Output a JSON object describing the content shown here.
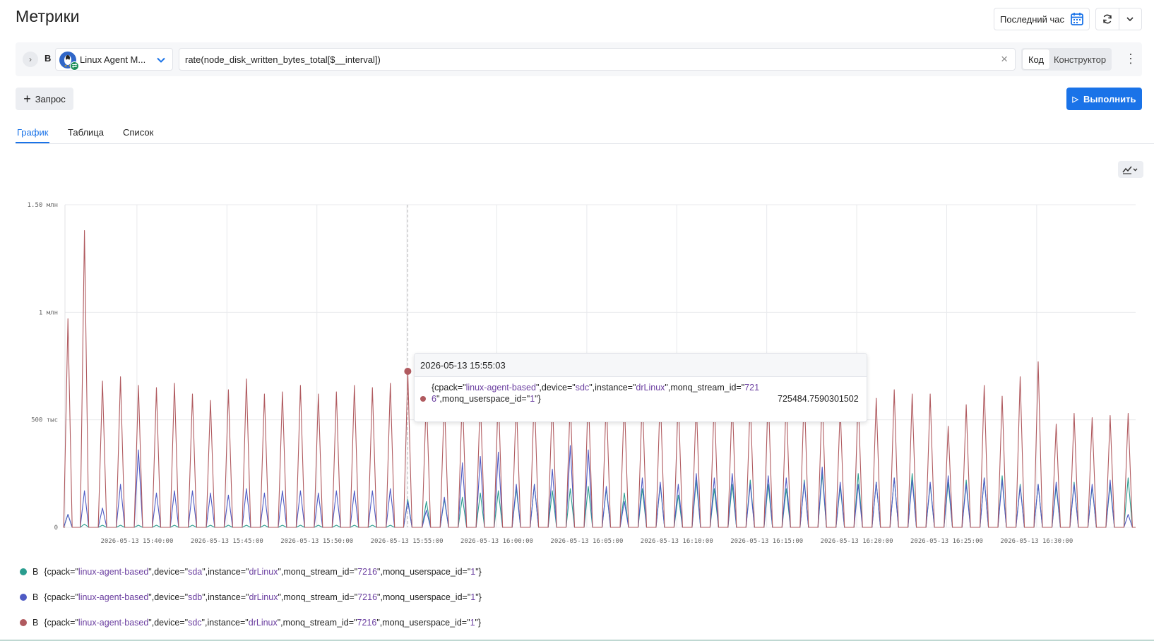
{
  "page": {
    "title": "Метрики"
  },
  "toolbar": {
    "time_range": "Последний час",
    "calendar_icon": "calendar-icon",
    "refresh_icon": "refresh-icon",
    "dropdown_icon": "chevron-down-icon"
  },
  "query": {
    "letter": "B",
    "datasource": "Linux Agent M...",
    "expression": "rate(node_disk_written_bytes_total[$__interval])",
    "modes": [
      "Код",
      "Конструктор"
    ],
    "active_mode": "Код"
  },
  "actions": {
    "add_query": "Запрос",
    "run": "Выполнить"
  },
  "tabs": [
    {
      "label": "График",
      "active": true
    },
    {
      "label": "Таблица",
      "active": false
    },
    {
      "label": "Список",
      "active": false
    }
  ],
  "colors": {
    "accent": "#1a73e8",
    "sda": "#2a9d8f",
    "sdb": "#4f5bc4",
    "sdc": "#b05a5f",
    "string": "#6b3fa0"
  },
  "chart_data": {
    "type": "line",
    "y_ticks": [
      "1.50 млн",
      "1 млн",
      "500 тыс",
      "0"
    ],
    "ylim": [
      0,
      1500000
    ],
    "x_ticks": [
      "2026-05-13 15:40:00",
      "2026-05-13 15:45:00",
      "2026-05-13 15:50:00",
      "2026-05-13 15:55:00",
      "2026-05-13 16:00:00",
      "2026-05-13 16:05:00",
      "2026-05-13 16:10:00",
      "2026-05-13 16:15:00",
      "2026-05-13 16:20:00",
      "2026-05-13 16:25:00",
      "2026-05-13 16:30:00"
    ],
    "x_range": [
      "2026-05-13 15:36:00",
      "2026-05-13 16:35:30"
    ],
    "grid": true,
    "spike_times": [
      "15:36:10",
      "15:37:05",
      "15:38:05",
      "15:39:05",
      "15:40:05",
      "15:41:05",
      "15:42:05",
      "15:43:05",
      "15:44:05",
      "15:45:05",
      "15:46:05",
      "15:47:05",
      "15:48:05",
      "15:49:05",
      "15:50:05",
      "15:51:05",
      "15:52:05",
      "15:53:05",
      "15:54:05",
      "15:55:03",
      "15:56:05",
      "15:57:05",
      "15:58:05",
      "15:59:05",
      "16:00:05",
      "16:01:05",
      "16:02:05",
      "16:03:05",
      "16:04:05",
      "16:05:05",
      "16:06:05",
      "16:07:05",
      "16:08:05",
      "16:09:05",
      "16:10:05",
      "16:11:05",
      "16:12:05",
      "16:13:05",
      "16:14:05",
      "16:15:05",
      "16:16:05",
      "16:17:05",
      "16:18:05",
      "16:19:05",
      "16:20:05",
      "16:21:05",
      "16:22:05",
      "16:23:05",
      "16:24:05",
      "16:25:05",
      "16:26:05",
      "16:27:05",
      "16:28:05",
      "16:29:05",
      "16:30:05",
      "16:31:05",
      "16:32:05",
      "16:33:05",
      "16:34:05",
      "16:35:05"
    ],
    "series": [
      {
        "id": "sda",
        "values": [
          60000,
          15000,
          10000,
          10000,
          10000,
          10000,
          10000,
          10000,
          10000,
          10000,
          10000,
          10000,
          10000,
          10000,
          10000,
          10000,
          10000,
          10000,
          10000,
          130000,
          120000,
          130000,
          140000,
          160000,
          170000,
          180000,
          200000,
          170000,
          180000,
          190000,
          180000,
          160000,
          180000,
          200000,
          150000,
          220000,
          180000,
          200000,
          220000,
          200000,
          180000,
          220000,
          250000,
          190000,
          250000,
          210000,
          230000,
          250000,
          200000,
          210000,
          220000,
          230000,
          240000,
          200000,
          200000,
          190000,
          210000,
          190000,
          200000,
          230000
        ]
      },
      {
        "id": "sdb",
        "values": [
          60000,
          170000,
          90000,
          200000,
          360000,
          160000,
          170000,
          170000,
          160000,
          150000,
          180000,
          160000,
          170000,
          170000,
          160000,
          170000,
          170000,
          170000,
          180000,
          120000,
          80000,
          140000,
          300000,
          330000,
          350000,
          200000,
          200000,
          270000,
          380000,
          360000,
          190000,
          120000,
          230000,
          210000,
          200000,
          250000,
          230000,
          250000,
          200000,
          240000,
          230000,
          210000,
          280000,
          210000,
          200000,
          210000,
          230000,
          220000,
          210000,
          240000,
          200000,
          230000,
          220000,
          190000,
          200000,
          210000,
          200000,
          200000,
          220000,
          60000
        ]
      },
      {
        "id": "sdc",
        "values": [
          970000,
          1380000,
          680000,
          700000,
          660000,
          650000,
          670000,
          620000,
          590000,
          640000,
          690000,
          620000,
          630000,
          660000,
          620000,
          630000,
          660000,
          650000,
          670000,
          725484.7590301502,
          620000,
          600000,
          630000,
          610000,
          630000,
          600000,
          640000,
          610000,
          600000,
          630000,
          610000,
          600000,
          620000,
          630000,
          610000,
          590000,
          600000,
          610000,
          600000,
          630000,
          610000,
          640000,
          620000,
          560000,
          610000,
          600000,
          640000,
          620000,
          620000,
          470000,
          570000,
          660000,
          610000,
          700000,
          770000,
          480000,
          530000,
          510000,
          520000,
          530000
        ]
      }
    ]
  },
  "tooltip": {
    "time": "2026-05-13 15:55:03",
    "label_prefix": "{cpack=\"",
    "cpack": "linux-agent-based",
    "device_key": "\",device=\"",
    "device": "sdc",
    "instance_key": "\",instance=\"",
    "instance": "drLinux",
    "stream_key": "\",monq_stream_id=\"",
    "stream_id": "7216",
    "userspace_key": "\",monq_userspace_id=\"",
    "userspace_id": "1",
    "label_suffix": "\"}",
    "value": "725484.7590301502"
  },
  "legend": [
    {
      "query": "B",
      "prefix": "{cpack=\"",
      "cpack": "linux-agent-based",
      "k1": "\",device=\"",
      "device": "sda",
      "k2": "\",instance=\"",
      "instance": "drLinux",
      "k3": "\",monq_stream_id=\"",
      "stream_id": "7216",
      "k4": "\",monq_userspace_id=\"",
      "userspace_id": "1",
      "suffix": "\"}"
    },
    {
      "query": "B",
      "prefix": "{cpack=\"",
      "cpack": "linux-agent-based",
      "k1": "\",device=\"",
      "device": "sdb",
      "k2": "\",instance=\"",
      "instance": "drLinux",
      "k3": "\",monq_stream_id=\"",
      "stream_id": "7216",
      "k4": "\",monq_userspace_id=\"",
      "userspace_id": "1",
      "suffix": "\"}"
    },
    {
      "query": "B",
      "prefix": "{cpack=\"",
      "cpack": "linux-agent-based",
      "k1": "\",device=\"",
      "device": "sdc",
      "k2": "\",instance=\"",
      "instance": "drLinux",
      "k3": "\",monq_stream_id=\"",
      "stream_id": "7216",
      "k4": "\",monq_userspace_id=\"",
      "userspace_id": "1",
      "suffix": "\"}"
    }
  ]
}
